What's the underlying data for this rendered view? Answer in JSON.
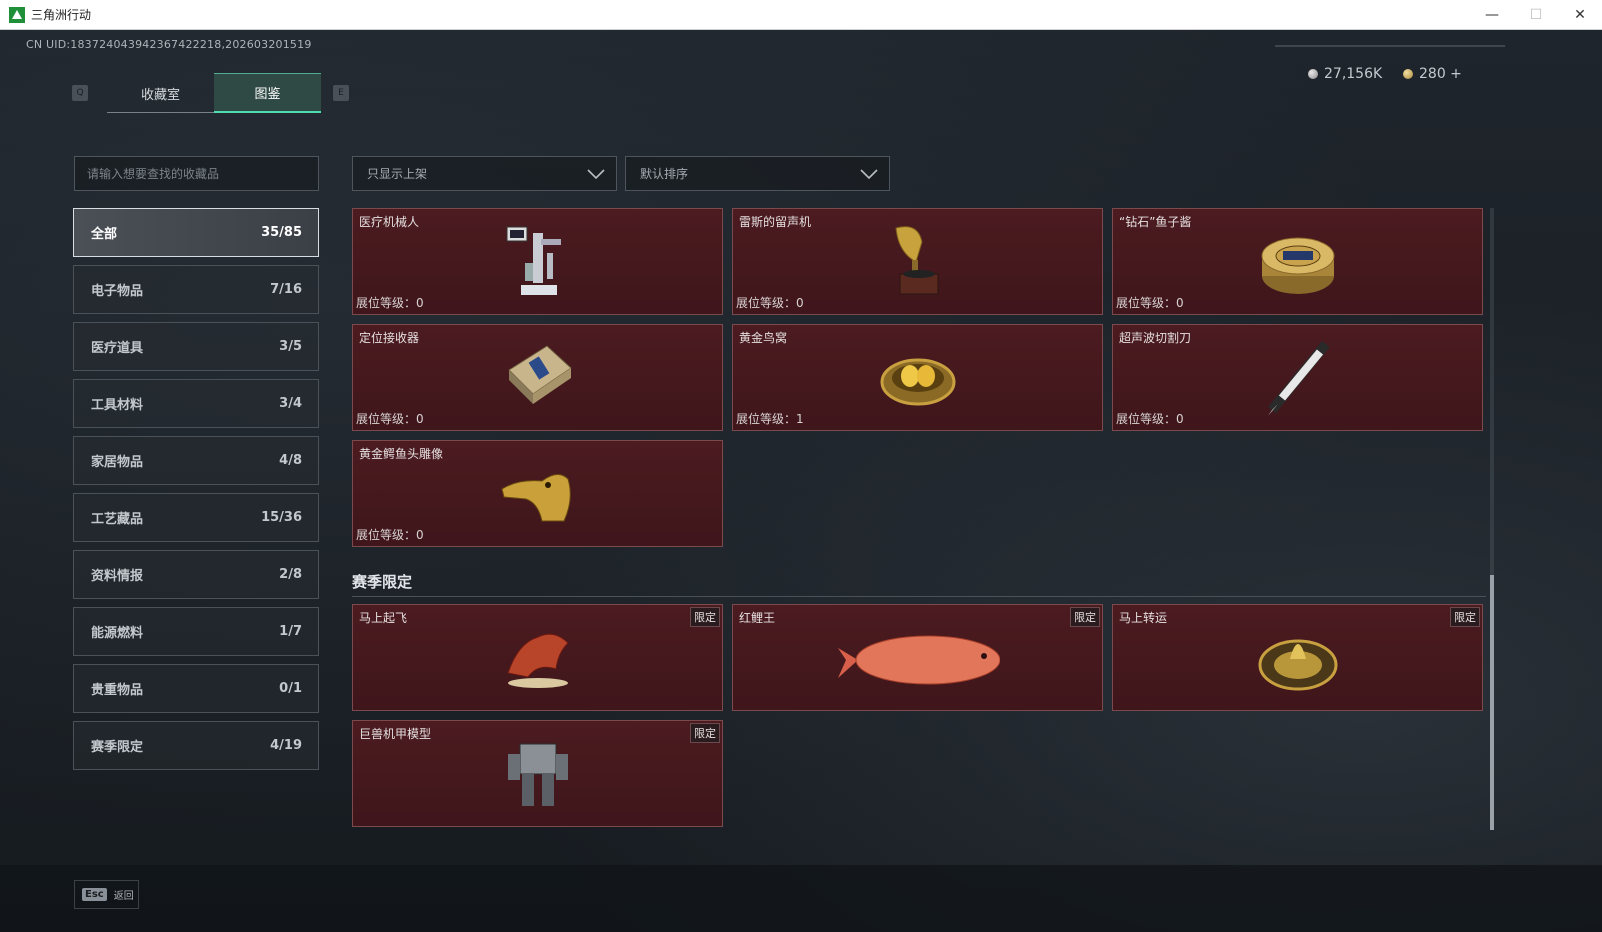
{
  "window": {
    "title": "三角洲行动",
    "minimize": "—",
    "maximize": "☐",
    "close": "✕"
  },
  "uid": "CN UID:183724043942367422218,202603201519",
  "key_prev": "Q",
  "key_next": "E",
  "tabs": [
    {
      "label": "收藏室",
      "active": false
    },
    {
      "label": "图鉴",
      "active": true
    }
  ],
  "currency": {
    "silver": "27,156K",
    "gold": "280 +"
  },
  "search": {
    "placeholder": "请输入想要查找的收藏品"
  },
  "filters": {
    "shelf": "只显示上架",
    "sort": "默认排序"
  },
  "categories": [
    {
      "label": "全部",
      "count": "35/85",
      "active": true
    },
    {
      "label": "电子物品",
      "count": "7/16"
    },
    {
      "label": "医疗道具",
      "count": "3/5"
    },
    {
      "label": "工具材料",
      "count": "3/4"
    },
    {
      "label": "家居物品",
      "count": "4/8"
    },
    {
      "label": "工艺藏品",
      "count": "15/36"
    },
    {
      "label": "资料情报",
      "count": "2/8"
    },
    {
      "label": "能源燃料",
      "count": "1/7"
    },
    {
      "label": "贵重物品",
      "count": "0/1"
    },
    {
      "label": "赛季限定",
      "count": "4/19"
    }
  ],
  "items": [
    {
      "name": "医疗机械人",
      "level": "展位等级：0",
      "icon": "medical-robot-icon"
    },
    {
      "name": "雷斯的留声机",
      "level": "展位等级：0",
      "icon": "gramophone-icon"
    },
    {
      "name": "“钻石”鱼子酱",
      "level": "展位等级：0",
      "icon": "caviar-tin-icon"
    },
    {
      "name": "定位接收器",
      "level": "展位等级：0",
      "icon": "gps-receiver-icon"
    },
    {
      "name": "黄金鸟窝",
      "level": "展位等级：1",
      "icon": "golden-nest-icon"
    },
    {
      "name": "超声波切割刀",
      "level": "展位等级：0",
      "icon": "ultrasonic-knife-icon"
    },
    {
      "name": "黄金鳄鱼头雕像",
      "level": "展位等级：0",
      "icon": "golden-crocodile-icon"
    }
  ],
  "season_section": {
    "title": "赛季限定",
    "badge": "限定",
    "items": [
      {
        "name": "马上起飞",
        "icon": "horse-statue-icon"
      },
      {
        "name": "红鲤王",
        "icon": "red-carp-icon"
      },
      {
        "name": "马上转运",
        "icon": "golden-compass-icon"
      },
      {
        "name": "巨兽机甲模型",
        "icon": "mech-model-icon"
      }
    ]
  },
  "footer": {
    "esc_key": "Esc",
    "esc_label": "返回"
  }
}
